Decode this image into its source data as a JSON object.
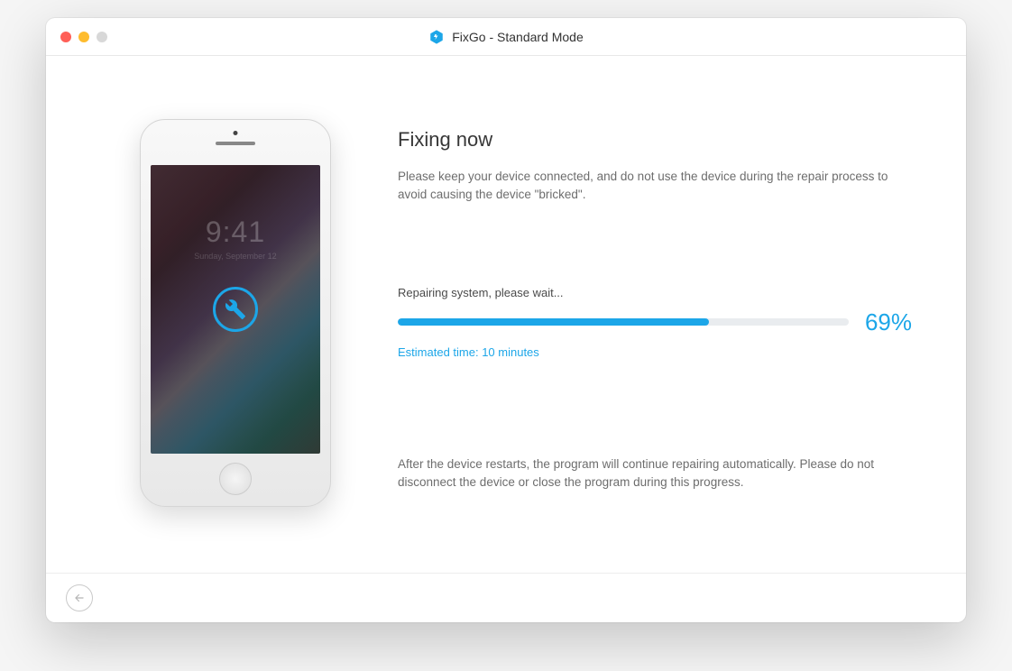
{
  "window": {
    "title": "FixGo - Standard Mode"
  },
  "device_mock": {
    "time": "9:41",
    "date": "Sunday, September 12"
  },
  "main": {
    "heading": "Fixing now",
    "description": "Please keep your device connected, and do not use the device during the repair process to avoid causing the device \"bricked\".",
    "status_label": "Repairing system, please wait...",
    "progress_percent": 69,
    "progress_display": "69%",
    "estimate": "Estimated time: 10 minutes",
    "footer_note": "After the device restarts, the program will continue repairing automatically. Please do not disconnect the device or close the program during this progress."
  },
  "colors": {
    "accent": "#1ca6e8"
  }
}
